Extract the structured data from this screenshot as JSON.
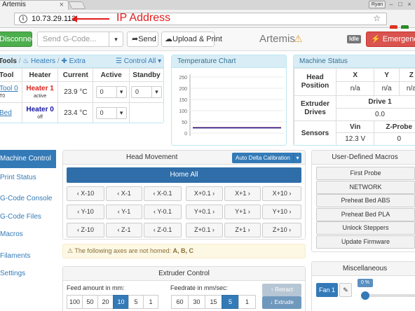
{
  "browser": {
    "tab_title": "Artemis",
    "tab_close": "×",
    "user_label": "Ryan",
    "window_controls": [
      "–",
      "□",
      "×"
    ],
    "url": "10.73.29.113",
    "annotation": "IP Address"
  },
  "navbar": {
    "disconnect": "Disconnect",
    "gcode_placeholder": "Send G-Code...",
    "send": "Send",
    "upload_print": "Upload & Print",
    "machine_name": "Artemis",
    "status_badge": "Idle",
    "emergency": "Emergency Stop"
  },
  "tools_panel": {
    "crumb_tools": "Tools",
    "crumb_heaters": "Heaters",
    "crumb_extra": "Extra",
    "control_all": "Control All",
    "headers": [
      "Tool",
      "Heater",
      "Current",
      "Active",
      "Standby"
    ],
    "rows": [
      {
        "tool": "Tool 0",
        "tool_sub": "T0",
        "heater": "Heater 1",
        "heater_state": "active",
        "current": "23.9 °C",
        "active": "0",
        "standby": "0"
      },
      {
        "tool": "Bed",
        "tool_sub": "",
        "heater": "Heater 0",
        "heater_state": "off",
        "current": "23.4 °C",
        "active": "0",
        "standby": ""
      }
    ]
  },
  "temp_chart": {
    "title": "Temperature Chart"
  },
  "chart_data": {
    "type": "line",
    "title": "Temperature Chart",
    "yticks": [
      250,
      200,
      150,
      100,
      50,
      0
    ],
    "ylim": [
      0,
      250
    ],
    "series": [
      {
        "color": "#e0242d",
        "values": [
          23.9,
          23.9
        ]
      },
      {
        "color": "#16168a",
        "values": [
          23.4,
          23.4
        ]
      }
    ]
  },
  "machine_status": {
    "title": "Machine Status",
    "head_position_label": "Head Position",
    "axes": [
      "X",
      "Y",
      "Z"
    ],
    "axis_values": [
      "n/a",
      "n/a",
      "n/a"
    ],
    "extruder_label": "Extruder Drives",
    "drive_label": "Drive 1",
    "drive_value": "0.0",
    "sensors_label": "Sensors",
    "vin_label": "Vin",
    "vin_value": "12.3 V",
    "zprobe_label": "Z-Probe",
    "zprobe_value": "0"
  },
  "sidebar": {
    "items": [
      "Machine Control",
      "Print Status",
      "G-Code Console",
      "G-Code Files",
      "Macros",
      "Filaments",
      "Settings"
    ]
  },
  "head_movement": {
    "title": "Head Movement",
    "auto_delta": "Auto Delta Calibration",
    "home_all": "Home All",
    "rows": [
      [
        "X-10",
        "X-1",
        "X-0.1",
        "X+0.1",
        "X+1",
        "X+10"
      ],
      [
        "Y-10",
        "Y-1",
        "Y-0.1",
        "Y+0.1",
        "Y+1",
        "Y+10"
      ],
      [
        "Z-10",
        "Z-1",
        "Z-0.1",
        "Z+0.1",
        "Z+1",
        "Z+10"
      ]
    ],
    "warning": "The following axes are not homed: ",
    "warning_axes": "A, B, C"
  },
  "macros": {
    "title": "User-Defined Macros",
    "items": [
      "First Probe",
      "NETWORK",
      "Preheat Bed ABS",
      "Preheat Bed PLA",
      "Unlock Steppers",
      "Update Firmware"
    ]
  },
  "extruder": {
    "title": "Extruder Control",
    "feed_label": "Feed amount in mm:",
    "feed_options": [
      "100",
      "50",
      "20",
      "10",
      "5",
      "1"
    ],
    "feed_selected": "10",
    "rate_label": "Feedrate in mm/sec:",
    "rate_options": [
      "60",
      "30",
      "15",
      "5",
      "1"
    ],
    "rate_selected": "5",
    "retract": "Retract",
    "extrude": "Extrude"
  },
  "misc": {
    "title": "Miscellaneous",
    "fan_label": "Fan 1",
    "fan_percent": "0 %",
    "fan_level": 0
  },
  "colors": {
    "primary": "#337ab7",
    "success": "#4cae4c",
    "danger": "#d9534f",
    "info_head": "#d9edf7",
    "annotation": "#e21b1b"
  }
}
